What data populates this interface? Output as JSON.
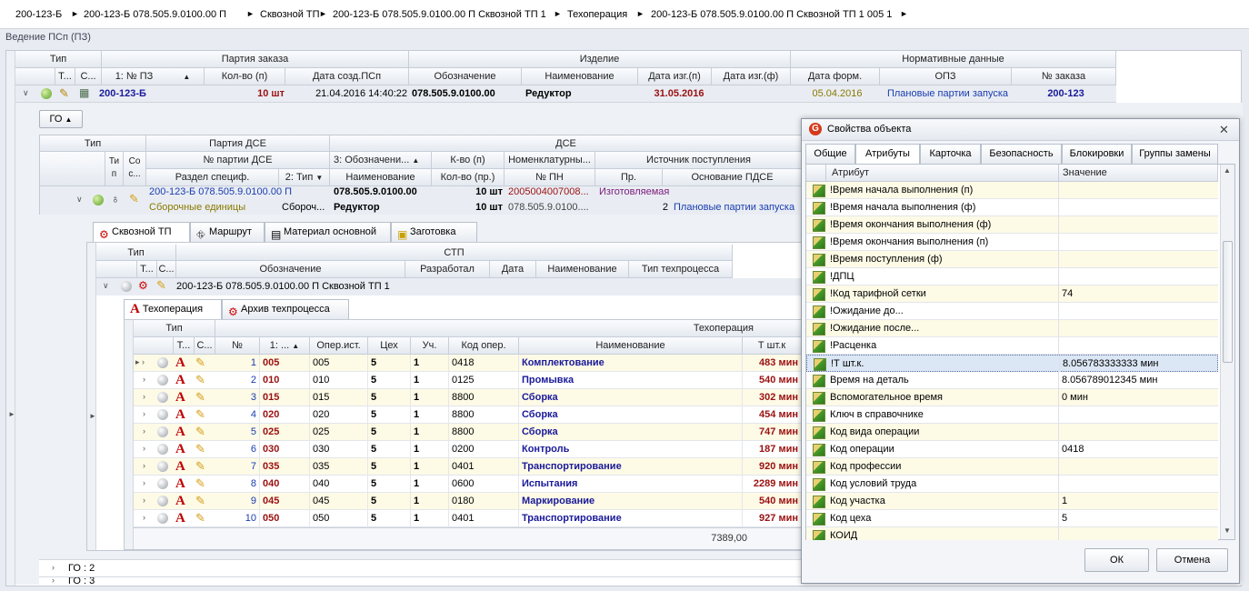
{
  "breadcrumb": [
    "200-123-Б",
    "200-123-Б 078.505.9.0100.00 П",
    "Сквозной ТП",
    "200-123-Б 078.505.9.0100.00 П Сквозной ТП 1",
    "Техоперация",
    "200-123-Б 078.505.9.0100.00 П Сквозной ТП 1 005 1"
  ],
  "panel_title": "Ведение ПСп (ПЗ)",
  "order_grid": {
    "group_headers": {
      "type": "Тип",
      "party": "Партия заказа",
      "product": "Изделие",
      "norm": "Нормативные данные"
    },
    "columns": {
      "t": "Т...",
      "s": "С...",
      "pz": "1: № ПЗ",
      "qty": "Кол-во (п)",
      "date_created": "Дата созд.ПСп",
      "designation": "Обозначение",
      "name": "Наименование",
      "date_made_plan": "Дата изг.(п)",
      "date_made_fact": "Дата изг.(ф)",
      "date_form": "Дата форм.",
      "opz": "ОПЗ",
      "order_no": "№ заказа"
    },
    "row": {
      "pz": "200-123-Б",
      "qty": "10 шт",
      "date_created": "21.04.2016 14:40:22",
      "designation": "078.505.9.0100.00",
      "name": "Редуктор",
      "date_plan": "31.05.2016",
      "date_form": "05.04.2016",
      "opz": "Плановые партии запуска",
      "order_no": "200-123"
    },
    "go_button": "ГО"
  },
  "dse_grid": {
    "group_headers": {
      "type": "Тип",
      "party": "Партия ДСЕ",
      "dse": "ДСЕ"
    },
    "columns": {
      "ti": "Ти п",
      "so": "Со с...",
      "party_no": "№ партии ДСЕ",
      "section": "Раздел специф.",
      "type2": "2: Тип",
      "designation": "3: Обозначени...",
      "qty": "К-во (п)",
      "nomen": "Номенклатурны...",
      "source": "Источник поступления",
      "name": "Наименование",
      "qty_pr": "Кол-во (пр.)",
      "pn": "№ ПН",
      "pr": "Пр.",
      "basis": "Основание ПДСЕ"
    },
    "row": {
      "party_no": "200-123-Б 078.505.9.0100.00 П",
      "section": "Сборочные единицы",
      "type2": "Сбороч...",
      "designation": "078.505.9.0100.00",
      "qty": "10 шт",
      "nomen": "2005004007008...",
      "source": "Изготовляемая",
      "name": "Редуктор",
      "qty_pr": "10 шт",
      "pn": "078.505.9.0100....",
      "pr": "2",
      "basis": "Плановые партии запуска"
    }
  },
  "tp_tabs": [
    "Сквозной ТП",
    "Маршрут",
    "Материал основной",
    "Заготовка"
  ],
  "stp_grid": {
    "group_headers": {
      "type": "Тип",
      "stp": "СТП"
    },
    "columns": {
      "t": "Т...",
      "s": "С...",
      "designation": "Обозначение",
      "dev": "Разработал",
      "date": "Дата",
      "name": "Наименование",
      "kind": "Тип техпроцесса"
    },
    "row": {
      "designation": "200-123-Б 078.505.9.0100.00 П Сквозной ТП 1"
    }
  },
  "op_tabs": [
    "Техоперация",
    "Архив техпроцесса"
  ],
  "op_grid": {
    "group_headers": {
      "type": "Тип",
      "op": "Техоперация"
    },
    "columns": {
      "t": "Т...",
      "s": "С...",
      "no": "№",
      "op": "1: ...",
      "src": "Опер.ист.",
      "shop": "Цех",
      "uch": "Уч.",
      "code": "Код опер.",
      "name": "Наименование",
      "tsh": "Т шт.к"
    },
    "rows": [
      {
        "no": "1",
        "op": "005",
        "src": "005",
        "shop": "5",
        "uch": "1",
        "code": "0418",
        "name": "Комплектование",
        "tsh": "483 мин"
      },
      {
        "no": "2",
        "op": "010",
        "src": "010",
        "shop": "5",
        "uch": "1",
        "code": "0125",
        "name": "Промывка",
        "tsh": "540 мин"
      },
      {
        "no": "3",
        "op": "015",
        "src": "015",
        "shop": "5",
        "uch": "1",
        "code": "8800",
        "name": "Сборка",
        "tsh": "302 мин"
      },
      {
        "no": "4",
        "op": "020",
        "src": "020",
        "shop": "5",
        "uch": "1",
        "code": "8800",
        "name": "Сборка",
        "tsh": "454 мин"
      },
      {
        "no": "5",
        "op": "025",
        "src": "025",
        "shop": "5",
        "uch": "1",
        "code": "8800",
        "name": "Сборка",
        "tsh": "747 мин"
      },
      {
        "no": "6",
        "op": "030",
        "src": "030",
        "shop": "5",
        "uch": "1",
        "code": "0200",
        "name": "Контроль",
        "tsh": "187 мин"
      },
      {
        "no": "7",
        "op": "035",
        "src": "035",
        "shop": "5",
        "uch": "1",
        "code": "0401",
        "name": "Транспортирование",
        "tsh": "920 мин"
      },
      {
        "no": "8",
        "op": "040",
        "src": "040",
        "shop": "5",
        "uch": "1",
        "code": "0600",
        "name": "Испытания",
        "tsh": "2289 мин"
      },
      {
        "no": "9",
        "op": "045",
        "src": "045",
        "shop": "5",
        "uch": "1",
        "code": "0180",
        "name": "Маркирование",
        "tsh": "540 мин"
      },
      {
        "no": "10",
        "op": "050",
        "src": "050",
        "shop": "5",
        "uch": "1",
        "code": "0401",
        "name": "Транспортирование",
        "tsh": "927 мин"
      }
    ],
    "total": "7389,00"
  },
  "go_rows": [
    "ГО : 2",
    "ГО : 3"
  ],
  "dialog": {
    "title": "Свойства объекта",
    "tabs": [
      "Общие",
      "Атрибуты",
      "Карточка",
      "Безопасность",
      "Блокировки",
      "Группы замены"
    ],
    "col_attr": "Атрибут",
    "col_value": "Значение",
    "rows": [
      {
        "name": "!Время начала выполнения (п)",
        "value": ""
      },
      {
        "name": "!Время начала выполнения (ф)",
        "value": ""
      },
      {
        "name": "!Время окончания выполнения  (ф)",
        "value": ""
      },
      {
        "name": "!Время окончания выполнения  (п)",
        "value": ""
      },
      {
        "name": "!Время поступления  (ф)",
        "value": ""
      },
      {
        "name": "!ДПЦ",
        "value": ""
      },
      {
        "name": "!Код тарифной сетки",
        "value": "74"
      },
      {
        "name": "!Ожидание до...",
        "value": ""
      },
      {
        "name": "!Ожидание после...",
        "value": ""
      },
      {
        "name": "!Расценка",
        "value": ""
      },
      {
        "name": "!Т шт.к.",
        "value": "8.056783333333 мин"
      },
      {
        "name": "Время на деталь",
        "value": "8.056789012345 мин"
      },
      {
        "name": "Вспомогательное время",
        "value": "0 мин"
      },
      {
        "name": "Ключ в справочнике",
        "value": ""
      },
      {
        "name": "Код вида операции",
        "value": ""
      },
      {
        "name": "Код операции",
        "value": "0418"
      },
      {
        "name": "Код профессии",
        "value": ""
      },
      {
        "name": "Код условий труда",
        "value": ""
      },
      {
        "name": "Код участка",
        "value": "1"
      },
      {
        "name": "Код цеха",
        "value": "5"
      },
      {
        "name": "КОИД",
        "value": ""
      }
    ],
    "ok": "ОК",
    "cancel": "Отмена"
  },
  "colors": {
    "accent_navy": "#1a1a9a",
    "accent_red": "#9a1010",
    "row_alt": "#fdfae6",
    "selected_row": "#dce7f5"
  }
}
